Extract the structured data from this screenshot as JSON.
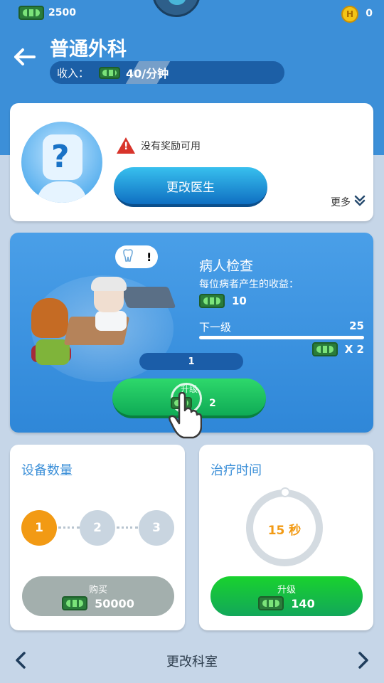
{
  "header": {
    "cash": "2500",
    "coins": "0",
    "coin_letter": "H",
    "title": "普通外科",
    "income_label": "收入：",
    "income_value": "40/分钟"
  },
  "doctor_card": {
    "portrait_symbol": "?",
    "warning_text": "没有奖励可用",
    "change_doctor_label": "更改医生",
    "more_label": "更多",
    "more_chevron": "»"
  },
  "exam_card": {
    "title": "病人检查",
    "revenue_label": "每位病者产生的收益：",
    "revenue_value": "10",
    "next_label": "下一级",
    "next_value": "25",
    "multiplier": "X 2",
    "level": "1",
    "upgrade_label": "升级",
    "upgrade_cost": "2",
    "bubble_icon": "tooth-icon",
    "bubble_mark": "!"
  },
  "equipment": {
    "heading": "设备数量",
    "steps": [
      "1",
      "2",
      "3"
    ],
    "active_step": 1,
    "buy_label": "购买",
    "buy_cost": "50000"
  },
  "treatment_time": {
    "heading": "治疗时间",
    "time_value": "15 秒",
    "upgrade_label": "升级",
    "upgrade_cost": "140"
  },
  "bottom_nav": {
    "label": "更改科室",
    "prev_arrow": "‹",
    "next_arrow": "›"
  },
  "colors": {
    "header_blue": "#3c8fd8",
    "accent_orange": "#f29a14",
    "upgrade_green": "#12a75a",
    "buy_gray": "#a3afad"
  }
}
